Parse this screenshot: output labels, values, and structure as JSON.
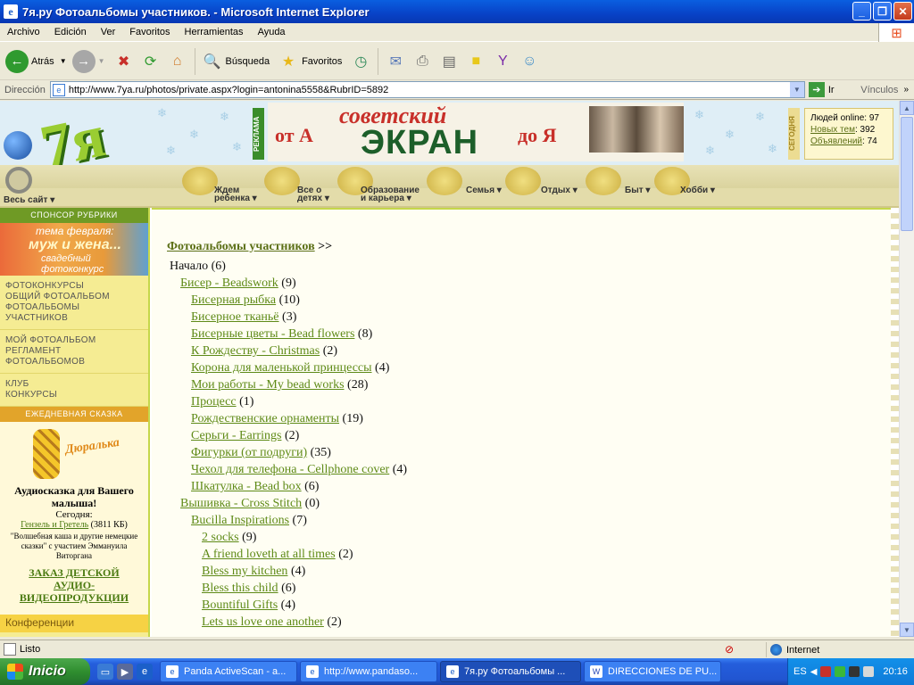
{
  "window": {
    "title": "7я.ру Фотоальбомы участников. - Microsoft Internet Explorer"
  },
  "menu": [
    "Archivo",
    "Edición",
    "Ver",
    "Favoritos",
    "Herramientas",
    "Ayuda"
  ],
  "toolbar": {
    "back": "Atrás",
    "search": "Búsqueda",
    "favorites": "Favoritos"
  },
  "address": {
    "label": "Dirección",
    "url": "http://www.7ya.ru/photos/private.aspx?login=antonina5558&RubrID=5892",
    "go": "Ir",
    "links": "Vínculos"
  },
  "banner": {
    "reklama": "РЕКЛАМА",
    "ad_from": "от А",
    "ad_soviet": "советский",
    "ad_screen": "ЭКРАН",
    "ad_to": "до Я",
    "segodnya": "СЕГОДНЯ",
    "stats": {
      "online_label": "Людей online:",
      "online_value": "97",
      "topics_label": "Новых тем",
      "topics_value": "392",
      "ads_label": "Объявлений",
      "ads_value": "74"
    }
  },
  "nav": {
    "all_site": "Весь сайт",
    "items": [
      [
        "Ждем",
        "ребенка"
      ],
      [
        "Все о",
        "детях"
      ],
      [
        "Образование",
        "и карьера"
      ],
      [
        "",
        "Семья"
      ],
      [
        "",
        "Отдых"
      ],
      [
        "",
        "Быт"
      ],
      [
        "",
        "Хобби"
      ]
    ]
  },
  "sidebar": {
    "sponsor": "СПОНСОР РУБРИКИ",
    "promo": {
      "l1": "тема февраля:",
      "l2": "муж и жена...",
      "l3": "свадебный",
      "l4": "фотоконкурс"
    },
    "group1": [
      "ФОТОКОНКУРСЫ",
      "ОБЩИЙ ФОТОАЛЬБОМ",
      "ФОТОАЛЬБОМЫ УЧАСТНИКОВ"
    ],
    "group2": [
      "МОЙ ФОТОАЛЬБОМ",
      "РЕГЛАМЕНТ ФОТОАЛЬБОМОВ"
    ],
    "group3": [
      "КЛУБ",
      "КОНКУРСЫ"
    ],
    "tale_head": "ЕЖЕДНЕВНАЯ СКАЗКА",
    "audio": {
      "logo_text": "Дюралька",
      "t1": "Аудиосказка для Вашего малыша!",
      "t2": "Сегодня:",
      "link": "Гензель и Гретель",
      "size": "(3811 КБ)",
      "desc": "\"Волшебная каша и другие немецкие сказки\" с участием Эммануила Виторгана",
      "order": "ЗАКАЗ ДЕТСКОЙ АУДИО-ВИДЕОПРОДУКЦИИ"
    },
    "konf": "Конференции"
  },
  "content": {
    "crumb_link": "Фотоальбомы участников",
    "crumb_tail": " >>",
    "tree": [
      {
        "level": 0,
        "label": "Начало",
        "count": "(6)",
        "link": false
      },
      {
        "level": 1,
        "label": "Бисер - Beadswork",
        "count": "(9)",
        "link": true
      },
      {
        "level": 2,
        "label": "Бисерная рыбка",
        "count": "(10)",
        "link": true
      },
      {
        "level": 2,
        "label": "Бисерное тканьё",
        "count": "(3)",
        "link": true
      },
      {
        "level": 2,
        "label": "Бисерные цветы - Bead flowers",
        "count": "(8)",
        "link": true
      },
      {
        "level": 2,
        "label": "К Рождеству - Christmas",
        "count": "(2)",
        "link": true
      },
      {
        "level": 2,
        "label": "Корона для маленькой принцессы",
        "count": "(4)",
        "link": true
      },
      {
        "level": 2,
        "label": "Мои работы - My bead works",
        "count": "(28)",
        "link": true
      },
      {
        "level": 2,
        "label": "Процесс",
        "count": "(1)",
        "link": true
      },
      {
        "level": 2,
        "label": "Рождественские орнаменты",
        "count": "(19)",
        "link": true
      },
      {
        "level": 2,
        "label": "Серьги - Earrings",
        "count": "(2)",
        "link": true
      },
      {
        "level": 2,
        "label": "Фигурки (от подруги)",
        "count": "(35)",
        "link": true
      },
      {
        "level": 2,
        "label": "Чехол для телефона - Cellphone cover",
        "count": "(4)",
        "link": true
      },
      {
        "level": 2,
        "label": "Шкатулка - Bead box",
        "count": "(6)",
        "link": true
      },
      {
        "level": 1,
        "label": "Вышивка - Cross Stitch",
        "count": "(0)",
        "link": true
      },
      {
        "level": 2,
        "label": "Bucilla Inspirations",
        "count": "(7)",
        "link": true
      },
      {
        "level": 3,
        "label": "2 socks",
        "count": "(9)",
        "link": true
      },
      {
        "level": 3,
        "label": "A friend loveth at all times",
        "count": "(2)",
        "link": true
      },
      {
        "level": 3,
        "label": "Bless my kitchen",
        "count": "(4)",
        "link": true
      },
      {
        "level": 3,
        "label": "Bless this child",
        "count": "(6)",
        "link": true
      },
      {
        "level": 3,
        "label": "Bountiful Gifts",
        "count": "(4)",
        "link": true
      },
      {
        "level": 3,
        "label": "Lets us love one another",
        "count": "(2)",
        "link": true
      }
    ]
  },
  "status": {
    "text": "Listo",
    "zone": "Internet"
  },
  "taskbar": {
    "start": "Inicio",
    "tasks": [
      "Panda ActiveScan - a...",
      "http://www.pandaso...",
      "7я.ру Фотоальбомы ...",
      "DIRECCIONES DE PU..."
    ],
    "lang": "ES",
    "clock": "20:16"
  }
}
